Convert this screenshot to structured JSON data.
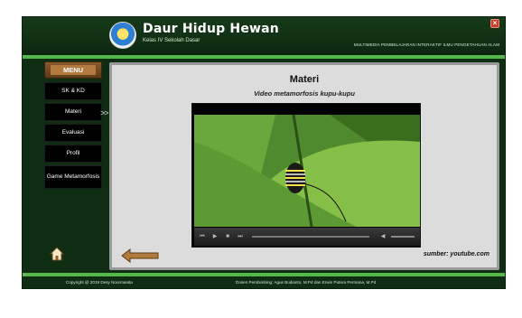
{
  "header": {
    "title": "Daur Hidup Hewan",
    "subtitle": "Kelas IV Sekolah Dasar",
    "tagline": "MULTIMEDIA PEMBELAJARAN INTERAKTIF ILMU PENGETAHUAN ALAM"
  },
  "sidebar": {
    "menu_label": "MENU",
    "items": [
      {
        "label": "SK & KD"
      },
      {
        "label": "Materi",
        "active": true
      },
      {
        "label": "Evaluasi"
      },
      {
        "label": "Profil"
      },
      {
        "label": "Game Metamorfosis"
      }
    ],
    "active_marker": ">>"
  },
  "content": {
    "title": "Materi",
    "subtitle": "Video metamorfosis kupu-kupu",
    "source": "sumber: youtube.com"
  },
  "footer": {
    "copyright": "Copyright @ 2019 Desy Nourmanita",
    "advisors": "Dosen Pembimbing: Agus Budianto, M.Pd dan Erwin Putera Permana, M.Pd"
  },
  "colors": {
    "background": "#0f2d12",
    "accent": "#54b84a",
    "panel": "#dcdcdc",
    "wood": "#8a5a2b"
  },
  "icons": {
    "home": "home-icon",
    "back": "back-arrow-icon",
    "close": "close-icon",
    "play": "play-icon",
    "volume": "volume-icon"
  }
}
